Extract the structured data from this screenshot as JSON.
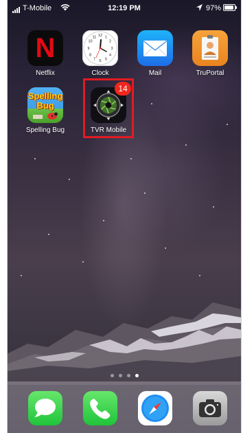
{
  "status_bar": {
    "carrier": "T-Mobile",
    "time": "12:19 PM",
    "battery": "97%",
    "icons": [
      "signal-icon",
      "wifi-icon",
      "location-icon",
      "battery-icon"
    ]
  },
  "home_screen": {
    "apps": [
      {
        "label": "Netflix",
        "icon": "netflix-icon",
        "glyph": "N"
      },
      {
        "label": "Clock",
        "icon": "clock-icon"
      },
      {
        "label": "Mail",
        "icon": "mail-icon"
      },
      {
        "label": "TruPortal",
        "icon": "truportal-icon"
      },
      {
        "label": "Spelling Bug",
        "icon": "spelling-bug-icon",
        "art_text": [
          "Spelling",
          "Bug"
        ]
      },
      {
        "label": "TVR Mobile",
        "icon": "tvr-mobile-icon",
        "badge": "14",
        "highlighted": true
      }
    ],
    "page_dots": {
      "count": 4,
      "active": 4
    }
  },
  "dock": {
    "apps": [
      {
        "name": "Messages",
        "icon": "messages-icon"
      },
      {
        "name": "Phone",
        "icon": "phone-icon"
      },
      {
        "name": "Safari",
        "icon": "safari-icon"
      },
      {
        "name": "Camera",
        "icon": "camera-icon"
      }
    ]
  },
  "colors": {
    "highlight": "#e21b23",
    "badge": "#f0271d",
    "netflix_red": "#e50914"
  }
}
